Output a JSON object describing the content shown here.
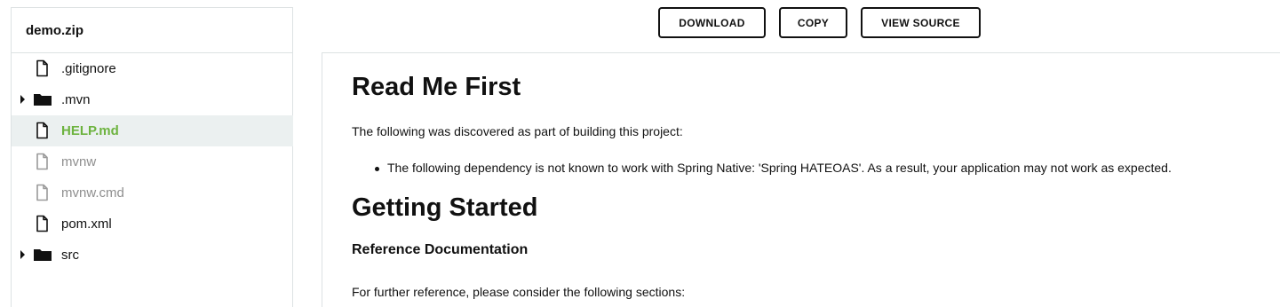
{
  "sidebar": {
    "title": "demo.zip",
    "items": [
      {
        "label": ".gitignore",
        "type": "file",
        "state": "normal"
      },
      {
        "label": ".mvn",
        "type": "folder",
        "state": "normal"
      },
      {
        "label": "HELP.md",
        "type": "file",
        "state": "selected"
      },
      {
        "label": "mvnw",
        "type": "file",
        "state": "muted"
      },
      {
        "label": "mvnw.cmd",
        "type": "file",
        "state": "muted"
      },
      {
        "label": "pom.xml",
        "type": "file",
        "state": "normal"
      },
      {
        "label": "src",
        "type": "folder",
        "state": "normal"
      }
    ]
  },
  "toolbar": {
    "download_label": "DOWNLOAD",
    "copy_label": "COPY",
    "view_source_label": "VIEW SOURCE"
  },
  "document": {
    "heading1": "Read Me First",
    "intro": "The following was discovered as part of building this project:",
    "bullet1": "The following dependency is not known to work with Spring Native: 'Spring HATEOAS'. As a result, your application may not work as expected.",
    "heading2": "Getting Started",
    "subheading": "Reference Documentation",
    "reference_intro": "For further reference, please consider the following sections:"
  },
  "colors": {
    "selected_text": "#6db33f",
    "selected_row_bg": "#ebf0f0",
    "muted_text": "#8f8f8f",
    "border": "#dde2e3"
  }
}
